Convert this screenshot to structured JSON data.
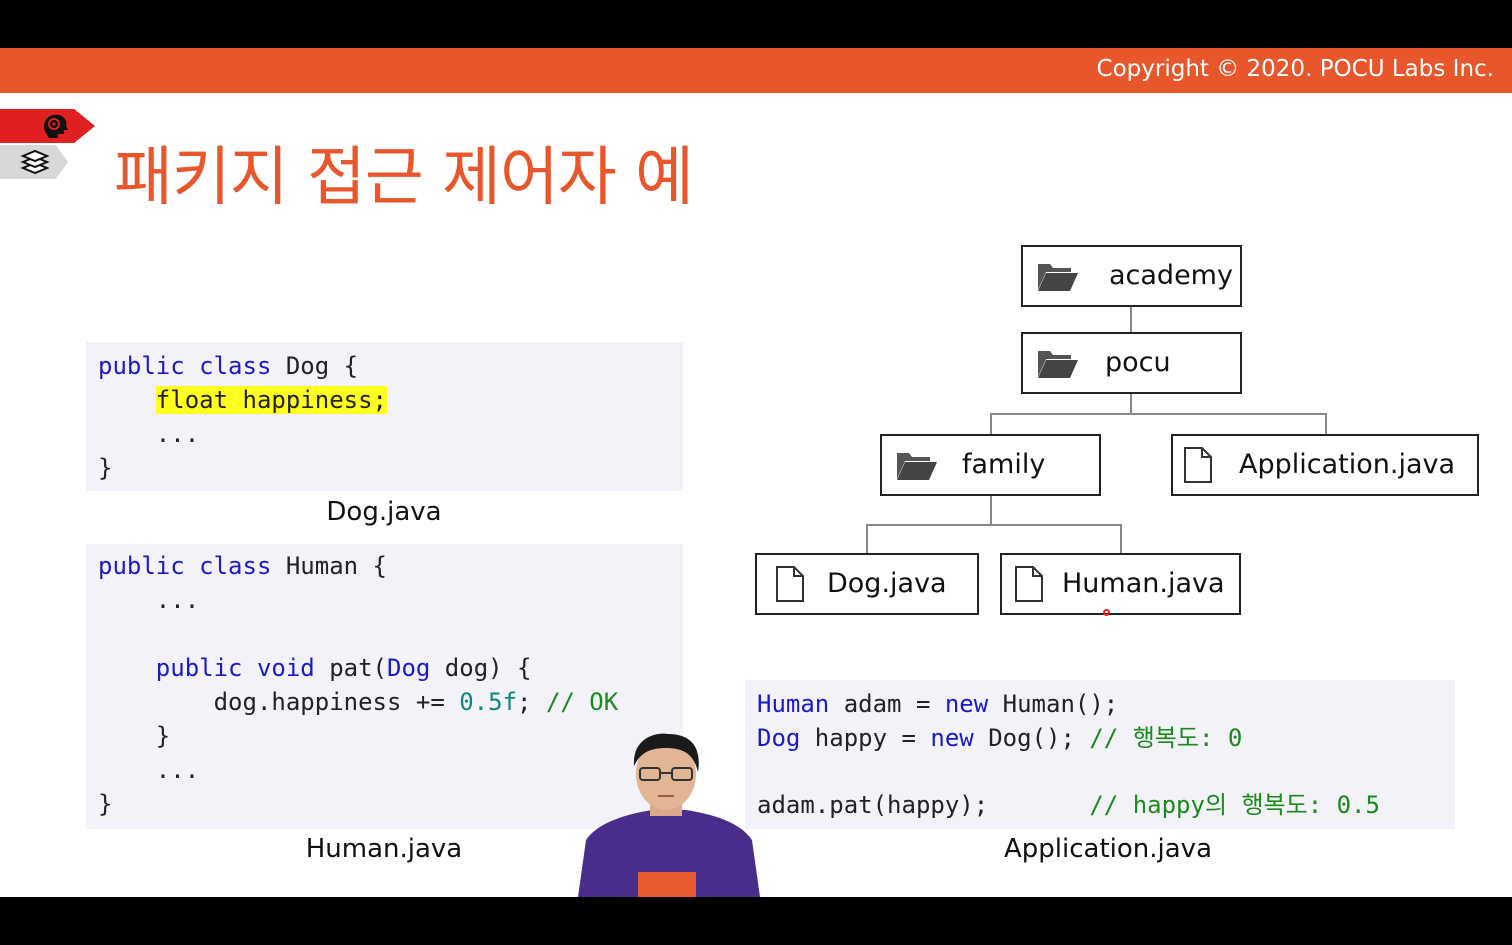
{
  "banner": {
    "copyright": "Copyright © 2020. POCU Labs Inc.",
    "color": "#e8562c"
  },
  "slide": {
    "title": "패키지 접근 제어자 예"
  },
  "dog_code": {
    "lines": [
      [
        {
          "t": "public class",
          "c": "kw"
        },
        {
          "t": " Dog {",
          "c": ""
        }
      ],
      [
        {
          "t": "    ",
          "c": ""
        },
        {
          "t": "float happiness;",
          "c": "hl"
        }
      ],
      [
        {
          "t": "    ...",
          "c": ""
        }
      ],
      [
        {
          "t": "}",
          "c": ""
        }
      ]
    ],
    "caption": "Dog.java"
  },
  "human_code": {
    "lines": [
      [
        {
          "t": "public class",
          "c": "kw"
        },
        {
          "t": " Human {",
          "c": ""
        }
      ],
      [
        {
          "t": "    ...",
          "c": ""
        }
      ],
      [
        {
          "t": "",
          "c": ""
        }
      ],
      [
        {
          "t": "    ",
          "c": ""
        },
        {
          "t": "public void",
          "c": "kw"
        },
        {
          "t": " pat(",
          "c": ""
        },
        {
          "t": "Dog",
          "c": "kw"
        },
        {
          "t": " dog) {",
          "c": ""
        }
      ],
      [
        {
          "t": "        dog.happiness += ",
          "c": ""
        },
        {
          "t": "0.5f",
          "c": "num"
        },
        {
          "t": "; ",
          "c": ""
        },
        {
          "t": "// OK",
          "c": "cm"
        }
      ],
      [
        {
          "t": "    }",
          "c": ""
        }
      ],
      [
        {
          "t": "    ...",
          "c": ""
        }
      ],
      [
        {
          "t": "}",
          "c": ""
        }
      ]
    ],
    "caption": "Human.java"
  },
  "app_code": {
    "lines": [
      [
        {
          "t": "Human",
          "c": "kw"
        },
        {
          "t": " adam = ",
          "c": ""
        },
        {
          "t": "new",
          "c": "kw"
        },
        {
          "t": " Human();",
          "c": ""
        }
      ],
      [
        {
          "t": "Dog",
          "c": "kw"
        },
        {
          "t": " happy = ",
          "c": ""
        },
        {
          "t": "new",
          "c": "kw"
        },
        {
          "t": " Dog(); ",
          "c": ""
        },
        {
          "t": "// 행복도: 0",
          "c": "cm"
        }
      ],
      [
        {
          "t": "",
          "c": ""
        }
      ],
      [
        {
          "t": "adam.pat(happy);       ",
          "c": ""
        },
        {
          "t": "// happy의 행복도: 0.5",
          "c": "cm"
        }
      ]
    ],
    "caption": "Application.java"
  },
  "tree": {
    "academy": {
      "label": "academy",
      "icon": "folder-icon"
    },
    "pocu": {
      "label": "pocu",
      "icon": "folder-icon"
    },
    "family": {
      "label": "family",
      "icon": "folder-icon"
    },
    "application": {
      "label": "Application.java",
      "icon": "file-icon"
    },
    "dog": {
      "label": "Dog.java",
      "icon": "file-icon"
    },
    "human": {
      "label": "Human.java",
      "icon": "file-icon"
    }
  }
}
